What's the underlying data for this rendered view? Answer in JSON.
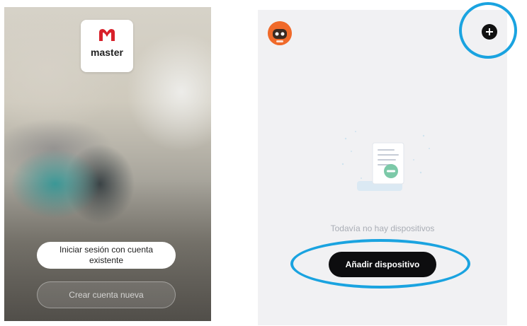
{
  "login_screen": {
    "logo_text": "master",
    "login_button_label": "Iniciar sesión con cuenta existente",
    "create_account_label": "Crear cuenta nueva"
  },
  "devices_screen": {
    "empty_message": "Todavía no hay dispositivos",
    "add_device_label": "Añadir dispositivo"
  },
  "icons": {
    "avatar": "robot-avatar-icon",
    "add": "plus-icon",
    "empty_state": "document-empty-illustration"
  },
  "colors": {
    "brand_red": "#d8202a",
    "highlight_blue": "#1aa3e0",
    "primary_button": "#0d0d0f",
    "avatar_orange": "#f06a2a"
  }
}
